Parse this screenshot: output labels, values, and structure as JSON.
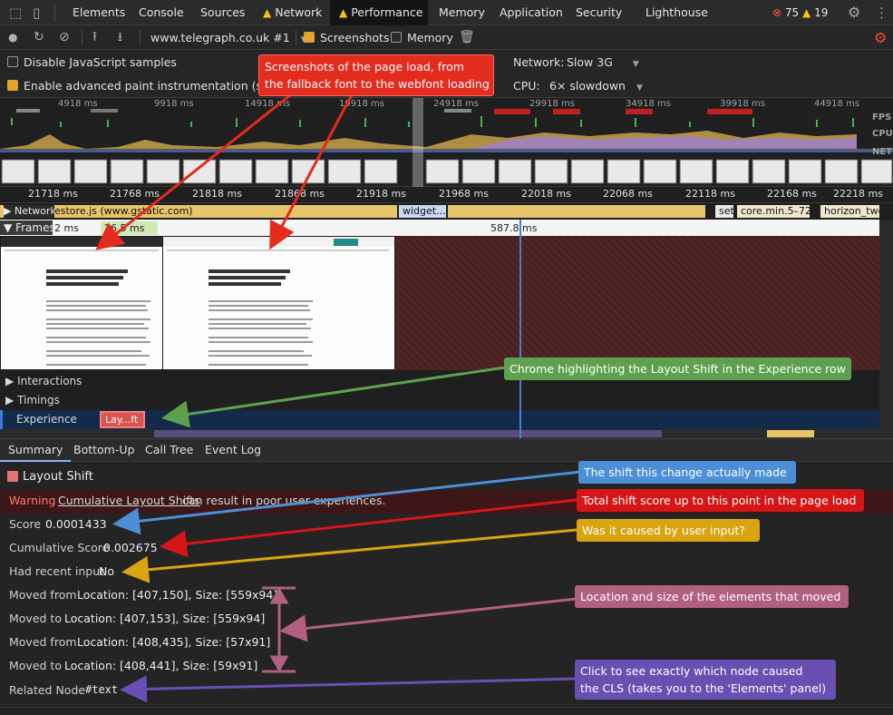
{
  "tabbar": {
    "tabs": [
      {
        "label": "Elements"
      },
      {
        "label": "Console"
      },
      {
        "label": "Sources"
      },
      {
        "label": "Network",
        "warning": true
      },
      {
        "label": "Performance",
        "warning": true,
        "active": true
      },
      {
        "label": "Memory"
      },
      {
        "label": "Application"
      },
      {
        "label": "Security"
      },
      {
        "label": "Lighthouse"
      }
    ],
    "error_count": "75",
    "warning_count": "19"
  },
  "toolbar": {
    "recording_target": "www.telegraph.co.uk #1",
    "screenshots_label": "Screenshots",
    "screenshots_checked": true,
    "memory_label": "Memory",
    "memory_checked": false
  },
  "settings": {
    "disable_js_samples": "Disable JavaScript samples",
    "advanced_paint": "Enable advanced paint instrumentation (slow)",
    "network_label": "Network:",
    "network_value": "Slow 3G",
    "cpu_label": "CPU:",
    "cpu_value": "6× slowdown"
  },
  "overview": {
    "ticks": [
      "4918 ms",
      "9918 ms",
      "14918 ms",
      "19918 ms",
      "24918 ms",
      "29918 ms",
      "34918 ms",
      "39918 ms",
      "44918 ms"
    ],
    "fps_label": "FPS",
    "cpu_label": "CPU",
    "net_label": "NET"
  },
  "ruler": {
    "ticks": [
      "21718 ms",
      "21768 ms",
      "21818 ms",
      "21868 ms",
      "21918 ms",
      "21968 ms",
      "22018 ms",
      "22068 ms",
      "22118 ms",
      "22168 ms",
      "22218 ms"
    ]
  },
  "network_track": {
    "label": "Network",
    "requests": [
      "estore.js (www.gstatic.com)",
      "widget...",
      "set",
      "core.min.5–72",
      "horizon_twe"
    ]
  },
  "frames": {
    "label": "Frames",
    "frame_times": [
      "2 ms",
      "26.5 ms",
      "587.8 ms"
    ]
  },
  "tracks": {
    "interactions": "Interactions",
    "timings": "Timings",
    "experience": "Experience",
    "layout_shift_chip": "Lay...ft"
  },
  "bottom_tabs": [
    {
      "label": "Summary",
      "active": true
    },
    {
      "label": "Bottom-Up"
    },
    {
      "label": "Call Tree"
    },
    {
      "label": "Event Log"
    }
  ],
  "summary": {
    "title": "Layout Shift",
    "warning_label": "Warning",
    "warning_link": "Cumulative Layout Shifts",
    "warning_rest": "can result in poor user experiences.",
    "score_label": "Score",
    "score_value": "0.0001433",
    "cumulative_label": "Cumulative Score",
    "cumulative_value": "0.002675",
    "recent_input_label": "Had recent input",
    "recent_input_value": "No",
    "moves": [
      {
        "label": "Moved from",
        "value": "Location: [407,150], Size: [559x94]"
      },
      {
        "label": "Moved to",
        "value": "Location: [407,153], Size: [559x94]"
      },
      {
        "label": "Moved from",
        "value": "Location: [408,435], Size: [57x91]"
      },
      {
        "label": "Moved to",
        "value": "Location: [408,441], Size: [59x91]"
      }
    ],
    "related_node_label": "Related Node",
    "related_node_value": "#text"
  },
  "callouts": {
    "screenshots_line1": "Screenshots of the page load, from",
    "screenshots_line2": "the fallback font to the webfont loading",
    "experience": "Chrome highlighting the Layout Shift in the Experience row",
    "score": "The shift this change actually made",
    "cumulative": "Total shift score up to this point in the page load",
    "recent_input": "Was it caused by user input?",
    "location": "Location and size of the elements that moved",
    "node_line1": "Click to see exactly which node caused",
    "node_line2": "the CLS (takes you to the 'Elements' panel)"
  },
  "colors": {
    "callout_red": "#e32b1e",
    "callout_green": "#5fa04e",
    "callout_blue": "#4d8fd6",
    "callout_yellow": "#d9a40f",
    "callout_pink": "#b1607f",
    "callout_purple": "#6a4fb3",
    "experience_row": "#132a4a",
    "layout_shift_chip": "#d9534f"
  }
}
